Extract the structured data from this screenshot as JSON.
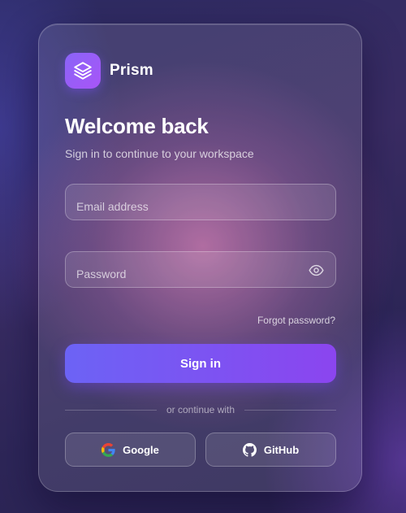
{
  "brand": {
    "name": "Prism",
    "logo_icon": "layers-icon",
    "accent": "#8a64f7"
  },
  "heading": {
    "title": "Welcome back",
    "subtitle": "Sign in to continue to your workspace"
  },
  "form": {
    "email": {
      "placeholder": "Email address",
      "value": ""
    },
    "password": {
      "placeholder": "Password",
      "value": "",
      "toggle_icon": "eye-icon"
    },
    "forgot_label": "Forgot password?",
    "submit_label": "Sign in",
    "submit_gradient": [
      "#6c63f5",
      "#8b45ef"
    ]
  },
  "divider": {
    "text": "or continue with"
  },
  "social": [
    {
      "label": "Google",
      "icon": "google-icon"
    },
    {
      "label": "GitHub",
      "icon": "github-icon"
    }
  ]
}
